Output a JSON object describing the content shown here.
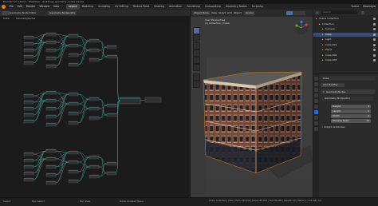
{
  "window": {
    "title": "Blender* [C:\\Users\\...\\Desktop\\...\\buildings_geometry_nodes.blend]"
  },
  "menu": [
    "File",
    "Edit",
    "Render",
    "Window",
    "Help"
  ],
  "workspaces": [
    "Layout",
    "Modeling",
    "Sculpting",
    "UV Editing",
    "Texture Paint",
    "Shading",
    "Animation",
    "Rendering",
    "Compositing",
    "Geometry Nodes",
    "Scripting"
  ],
  "active_workspace": "Layout",
  "node_editor": {
    "breadcrumb": [
      "Cube",
      "GeometryNodes"
    ],
    "node_group": "Geometry Nodes.001",
    "editor_type": "Geometry Node Editor"
  },
  "viewport": {
    "mode": "Object Mode",
    "view_label": "User Perspective",
    "collection_label": "(1) Collection | Cube",
    "menus": [
      "View",
      "Select",
      "Add",
      "Object"
    ],
    "transform": "Global",
    "wall_color": "#7a4a35",
    "window_color": "#1c2330"
  },
  "outliner": {
    "search_placeholder": "Search",
    "scene": "Scene",
    "view_layer": "ViewLayer",
    "items": [
      {
        "label": "Scene Collection",
        "indent": 0,
        "selected": false
      },
      {
        "label": "Collection",
        "indent": 1,
        "selected": false
      },
      {
        "label": "Camera",
        "indent": 2,
        "selected": false
      },
      {
        "label": "Cube",
        "indent": 2,
        "selected": true
      },
      {
        "label": "Light",
        "indent": 2,
        "selected": false
      },
      {
        "label": "Cube.001",
        "indent": 2,
        "selected": false
      },
      {
        "label": "Plane",
        "indent": 2,
        "selected": false
      },
      {
        "label": "Cube.002",
        "indent": 2,
        "selected": false
      },
      {
        "label": "Cube.003",
        "indent": 2,
        "selected": false
      }
    ]
  },
  "properties": {
    "object_name": "Cube",
    "modifier_panel": "Add Modifier",
    "modifier_name": "GeometryNodes",
    "node_group": "Geometry Nodes.001",
    "fields": [
      {
        "label": "Height",
        "value": "4"
      },
      {
        "label": "Length",
        "value": "5"
      },
      {
        "label": "Width",
        "value": "4"
      },
      {
        "label": "Window Seed",
        "value": "12"
      }
    ],
    "output_attributes": "Output Attributes"
  },
  "status": {
    "select": "Select",
    "box_select": "Box Select",
    "pan": "Pan View",
    "context_menu": "Node Context Menu",
    "stats": "Scene Collection | Cube | Verts:245,520 | Faces:167,200 | Tris:334,400 | Objects:1/3 | Memory: 1.14 GiB | 3.4"
  },
  "colors": {
    "accent": "#e87d0d",
    "wire": "#2fbf9e",
    "selection": "#334d80",
    "active_tab": "#1f6ed2"
  }
}
